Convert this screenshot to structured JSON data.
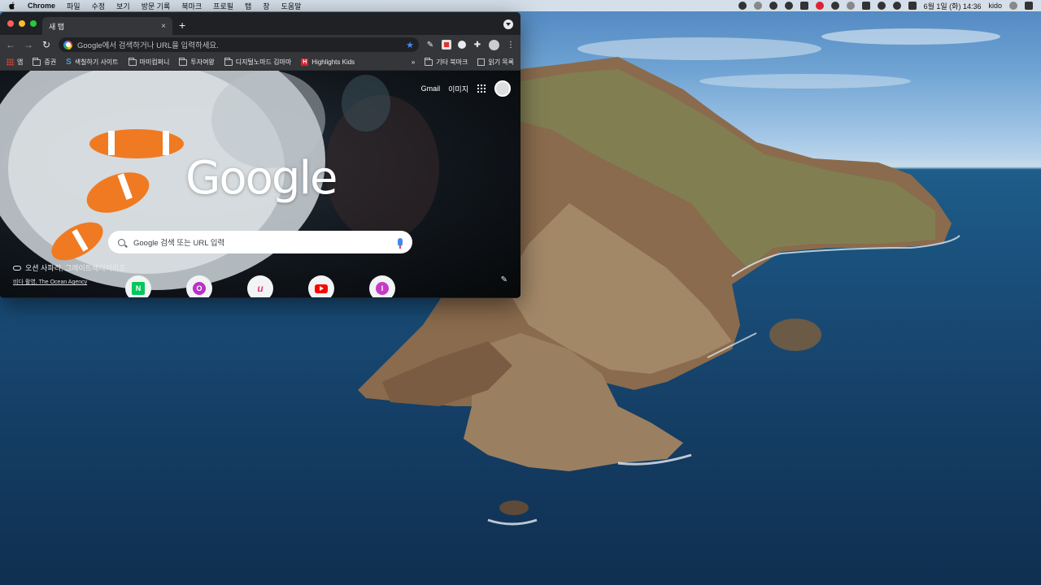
{
  "menubar": {
    "app_name": "Chrome",
    "menus": [
      "파일",
      "수정",
      "보기",
      "방문 기록",
      "북마크",
      "프로필",
      "탭",
      "창",
      "도움말"
    ],
    "datetime": "6월 1일 (화) 14:36",
    "user": "kido"
  },
  "browser": {
    "tab_title": "새 탭",
    "tab_close": "×",
    "new_tab": "+",
    "omnibox_placeholder": "Google에서 검색하거나 URL을 입력하세요.",
    "bookmarks": {
      "apps": "앱",
      "items": [
        "증권",
        "색칠하기 사이트",
        "마미컴퍼니",
        "투자여왕",
        "디지털노마드 김마마",
        "Highlights Kids"
      ],
      "overflow": "»",
      "other": "기타 북마크",
      "reading_list": "읽기 목록"
    }
  },
  "ntp": {
    "gmail": "Gmail",
    "images": "이미지",
    "logo": "Google",
    "search_placeholder": "Google 검색 또는 URL 입력",
    "credit_title": "오션 사파리, 그레이트배리어리프",
    "credit_author": "비다 촬영, The Ocean Agency",
    "shortcuts": [
      "N",
      "O",
      "u",
      "",
      "I"
    ]
  }
}
